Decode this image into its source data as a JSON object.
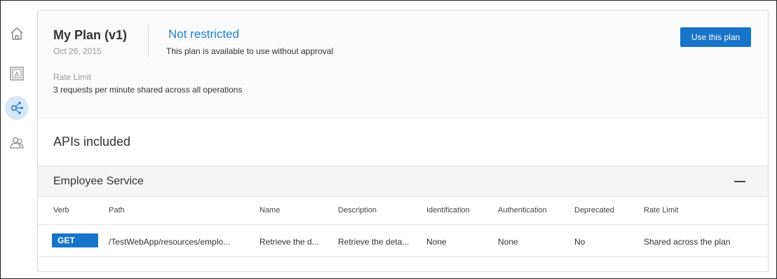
{
  "plan": {
    "title": "My Plan (v1)",
    "date": "Oct 26, 2015",
    "restriction_title": "Not restricted",
    "restriction_desc": "This plan is available to use without approval",
    "use_button": "Use this plan",
    "rate_limit_label": "Rate Limit",
    "rate_limit_value": "3 requests per minute shared across all operations"
  },
  "apis": {
    "title": "APIs included",
    "service_name": "Employee Service",
    "columns": [
      "Verb",
      "Path",
      "Name",
      "Description",
      "Identification",
      "Authentication",
      "Deprecated",
      "Rate Limit"
    ],
    "rows": [
      {
        "verb": "GET",
        "path": "/TestWebApp/resources/emplo...",
        "name": "Retrieve the d...",
        "description": "Retrieve the deta...",
        "identification": "None",
        "authentication": "None",
        "deprecated": "No",
        "rate_limit": "Shared across the plan"
      }
    ]
  },
  "sidebar": {
    "icons": [
      "home-icon",
      "text-block-icon",
      "network-icon",
      "users-icon"
    ],
    "active": "network-icon"
  },
  "colors": {
    "accent": "#1874c9",
    "link": "#1f7fd4",
    "active_rail": "#d7e7f6"
  }
}
